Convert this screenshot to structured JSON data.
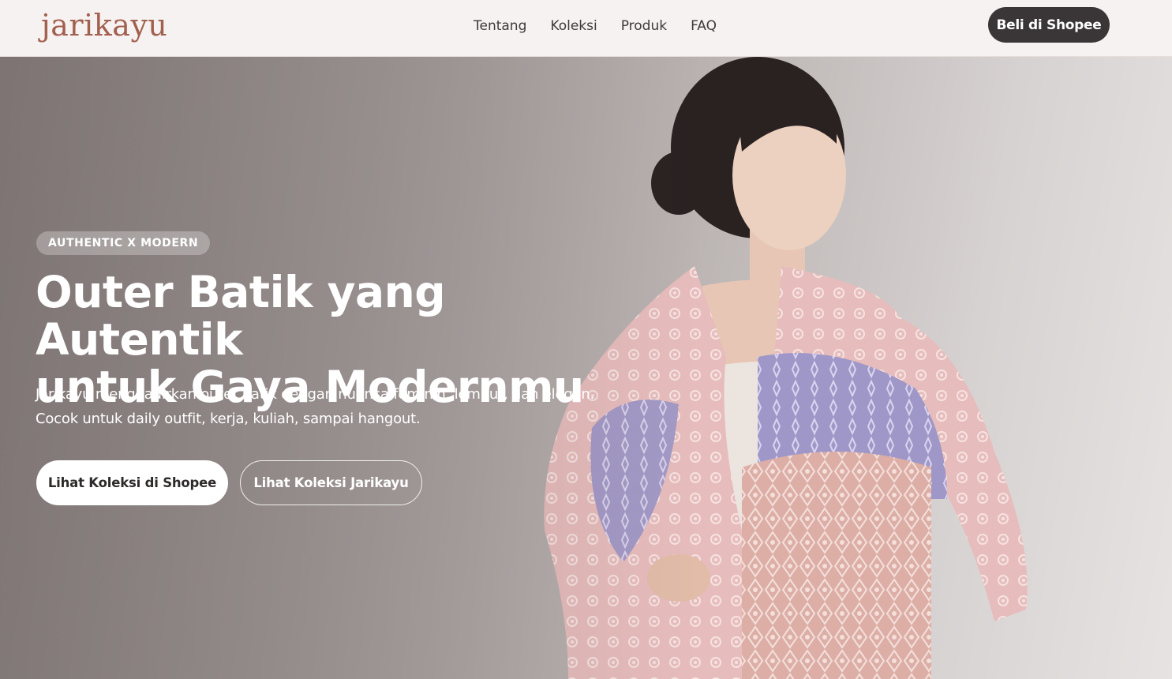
{
  "header": {
    "logo": "jarikayu",
    "nav": [
      "Tentang",
      "Koleksi",
      "Produk",
      "FAQ"
    ],
    "cta": "Beli di Shopee"
  },
  "hero": {
    "badge": "AUTHENTIC X MODERN",
    "title_line1": "Outer Batik yang Autentik",
    "title_line2": "untuk Gaya Modernmu",
    "desc_line1": "Jarikayu menghadirkan outer batik dengan nuansa feminin, lembut, dan elegan.",
    "desc_line2": "Cocok untuk daily outfit, kerja, kuliah, sampai hangout.",
    "primary_button": "Lihat Koleksi di Shopee",
    "secondary_button": "Lihat Koleksi Jarikayu"
  },
  "colors": {
    "brand": "#a2604e",
    "dark_button": "#3a3536",
    "header_bg": "#f6f2f1"
  }
}
